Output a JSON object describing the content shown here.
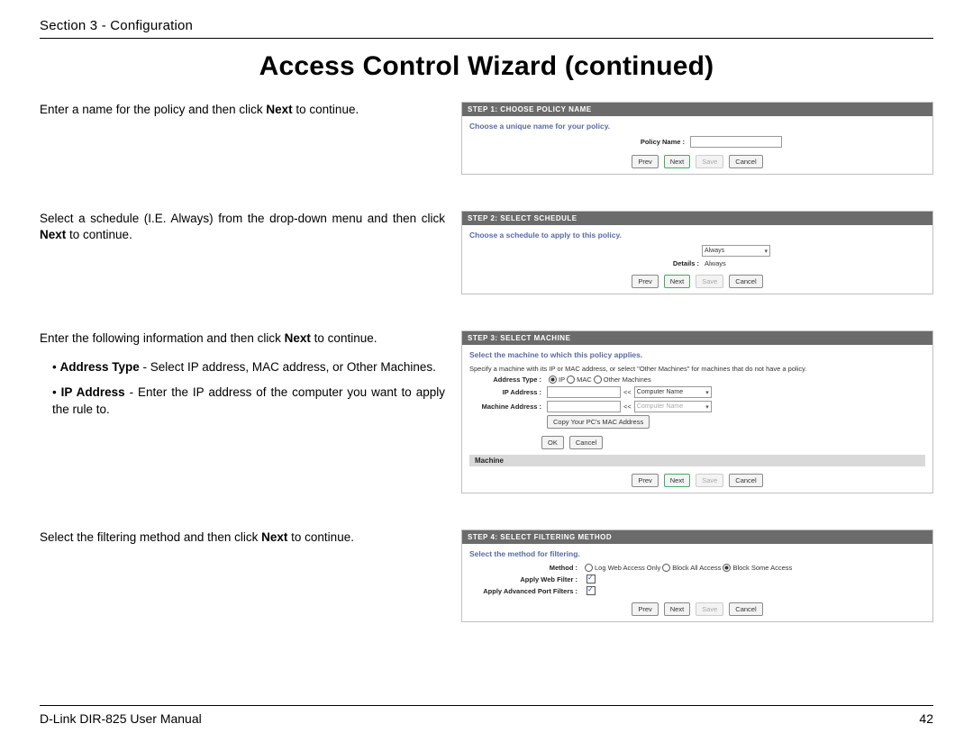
{
  "header": {
    "section": "Section 3 - Configuration"
  },
  "title": "Access Control Wizard (continued)",
  "step1": {
    "instruction_a": "Enter a name for the policy and then click ",
    "instruction_bold": "Next",
    "instruction_b": " to continue.",
    "panel_header": "STEP 1: CHOOSE POLICY NAME",
    "panel_blue": "Choose a unique name for your policy.",
    "label": "Policy Name :",
    "btn_prev": "Prev",
    "btn_next": "Next",
    "btn_save": "Save",
    "btn_cancel": "Cancel"
  },
  "step2": {
    "instruction_a": "Select a schedule (I.E. Always) from the drop-down menu and then click ",
    "instruction_bold": "Next",
    "instruction_b": " to continue.",
    "panel_header": "STEP 2: SELECT SCHEDULE",
    "panel_blue": "Choose a schedule to apply to this policy.",
    "sel_value": "Always",
    "details_label": "Details :",
    "details_value": "Always",
    "btn_prev": "Prev",
    "btn_next": "Next",
    "btn_save": "Save",
    "btn_cancel": "Cancel"
  },
  "step3": {
    "instruction_a": "Enter the following information and then click ",
    "instruction_bold": "Next",
    "instruction_b": " to continue.",
    "bullet1_bold": "Address Type",
    "bullet1_rest": " - Select IP address, MAC address, or Other Machines.",
    "bullet2_bold": "IP Address",
    "bullet2_rest": " - Enter the IP address of the computer you want to apply the rule to.",
    "panel_header": "STEP 3: SELECT MACHINE",
    "panel_blue": "Select the machine to which this policy applies.",
    "panel_note": "Specify a machine with its IP or MAC address, or select \"Other Machines\" for machines that do not have a policy.",
    "addr_type": "Address Type :",
    "r_ip": "IP",
    "r_mac": "MAC",
    "r_other": "Other Machines",
    "ip_label": "IP Address :",
    "mac_label": "Machine Address :",
    "arrow": "<<",
    "cname": "Computer Name",
    "copy": "Copy Your PC's MAC Address",
    "ok": "OK",
    "clear": "Cancel",
    "machine_hdr": "Machine",
    "btn_prev": "Prev",
    "btn_next": "Next",
    "btn_save": "Save",
    "btn_cancel": "Cancel"
  },
  "step4": {
    "instruction_a": "Select the filtering method and then click ",
    "instruction_bold": "Next",
    "instruction_b": " to continue.",
    "panel_header": "STEP 4: SELECT FILTERING METHOD",
    "panel_blue": "Select the method for filtering.",
    "method_label": "Method :",
    "m1": "Log Web Access Only",
    "m2": "Block All Access",
    "m3": "Block Some Access",
    "web_label": "Apply Web Filter :",
    "port_label": "Apply Advanced Port Filters :",
    "btn_prev": "Prev",
    "btn_next": "Next",
    "btn_save": "Save",
    "btn_cancel": "Cancel"
  },
  "footer": {
    "left": "D-Link DIR-825 User Manual",
    "right": "42"
  }
}
